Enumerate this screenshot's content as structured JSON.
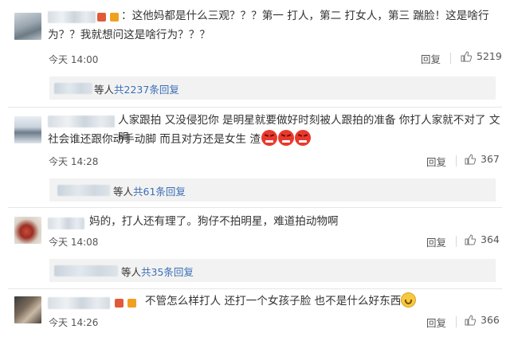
{
  "comments": [
    {
      "text_line1": "：这他妈都是什么三观？？？第一 打人，第二 打女人，第三 踹脸！这是啥行",
      "text_line2": "为？？我就想问这是啥行为？？？",
      "time": "今天 14:00",
      "reply_label": "回复",
      "likes": "5219",
      "sub": {
        "suffix": "等人",
        "count": "共2237条回复"
      }
    },
    {
      "text_line1": "人家跟拍 又没侵犯你 是明星就要做好时刻被人跟拍的准备 你打人家就不对了 文明",
      "text_line2": "社会谁还跟你动手动脚 而且对方还是女生 渣",
      "time": "今天 14:28",
      "reply_label": "回复",
      "likes": "367",
      "sub": {
        "suffix": "等人",
        "count": "共61条回复"
      }
    },
    {
      "text_line1": "妈的，打人还有理了。狗仔不拍明星，难道拍动物啊",
      "time": "今天 14:08",
      "reply_label": "回复",
      "likes": "364",
      "sub": {
        "suffix": "等人",
        "count": "共35条回复"
      }
    },
    {
      "text_line1": "不管怎么样打人 还打一个女孩子脸 也不是什么好东西",
      "time": "今天 14:26",
      "reply_label": "回复",
      "likes": "366"
    }
  ],
  "icons": {
    "like": "thumbs-up-icon",
    "angry": "angry-face-emoji",
    "sweat": "sweat-smile-emoji"
  },
  "colors": {
    "link": "#3b6fb6",
    "angry_emoji": "#e8392d"
  }
}
